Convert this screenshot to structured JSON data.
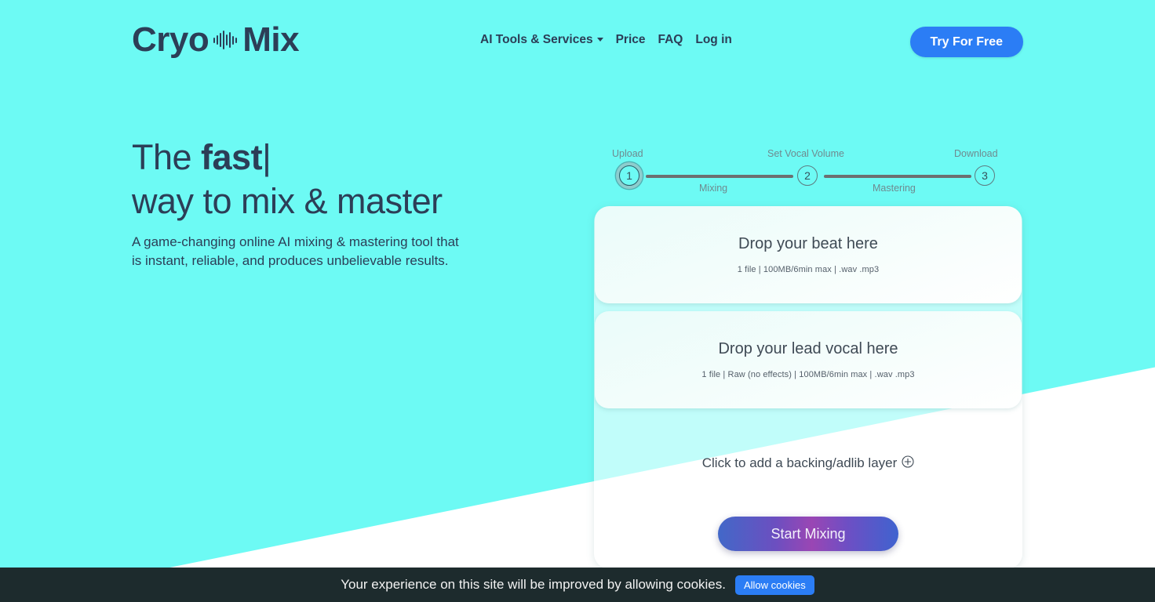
{
  "header": {
    "logo": {
      "part1": "Cryo",
      "part2": "Mix",
      "icon": "audio-waveform-icon"
    },
    "nav": [
      {
        "label": "AI Tools & Services",
        "has_dropdown": true
      },
      {
        "label": "Price",
        "has_dropdown": false
      },
      {
        "label": "FAQ",
        "has_dropdown": false
      },
      {
        "label": "Log in",
        "has_dropdown": false
      }
    ],
    "cta_label": "Try For Free",
    "cta_color": "#2b7df5"
  },
  "hero": {
    "line1_prefix": "The ",
    "line1_bold": "fast",
    "line1_caret": "|",
    "line2": "way to mix & master",
    "paragraph": "A game-changing online AI mixing & mastering tool that is instant, reliable, and produces unbelievable results."
  },
  "stepper": {
    "steps": [
      {
        "number": "1",
        "label": "Upload",
        "active": true
      },
      {
        "number": "2",
        "label": "Set Vocal Volume",
        "active": false
      },
      {
        "number": "3",
        "label": "Download",
        "active": false
      }
    ],
    "segments": [
      {
        "label": "Mixing"
      },
      {
        "label": "Mastering"
      }
    ]
  },
  "panel": {
    "dropzones": [
      {
        "title": "Drop your beat here",
        "subtitle": "1 file | 100MB/6min max | .wav .mp3"
      },
      {
        "title": "Drop your lead vocal here",
        "subtitle": "1 file | Raw (no effects) | 100MB/6min max | .wav .mp3"
      }
    ],
    "add_layer_label": "Click to add a backing/adlib layer",
    "add_layer_icon": "circled-plus-icon",
    "submit_label": "Start Mixing"
  },
  "cookie_banner": {
    "message": "Your experience on this site will be improved by allowing cookies.",
    "button_label": "Allow cookies"
  },
  "theme": {
    "background": "#6dfaf4",
    "text_dark": "#2c3e57",
    "accent_blue": "#2b7df5",
    "banner_bg": "#1d2b2d"
  }
}
